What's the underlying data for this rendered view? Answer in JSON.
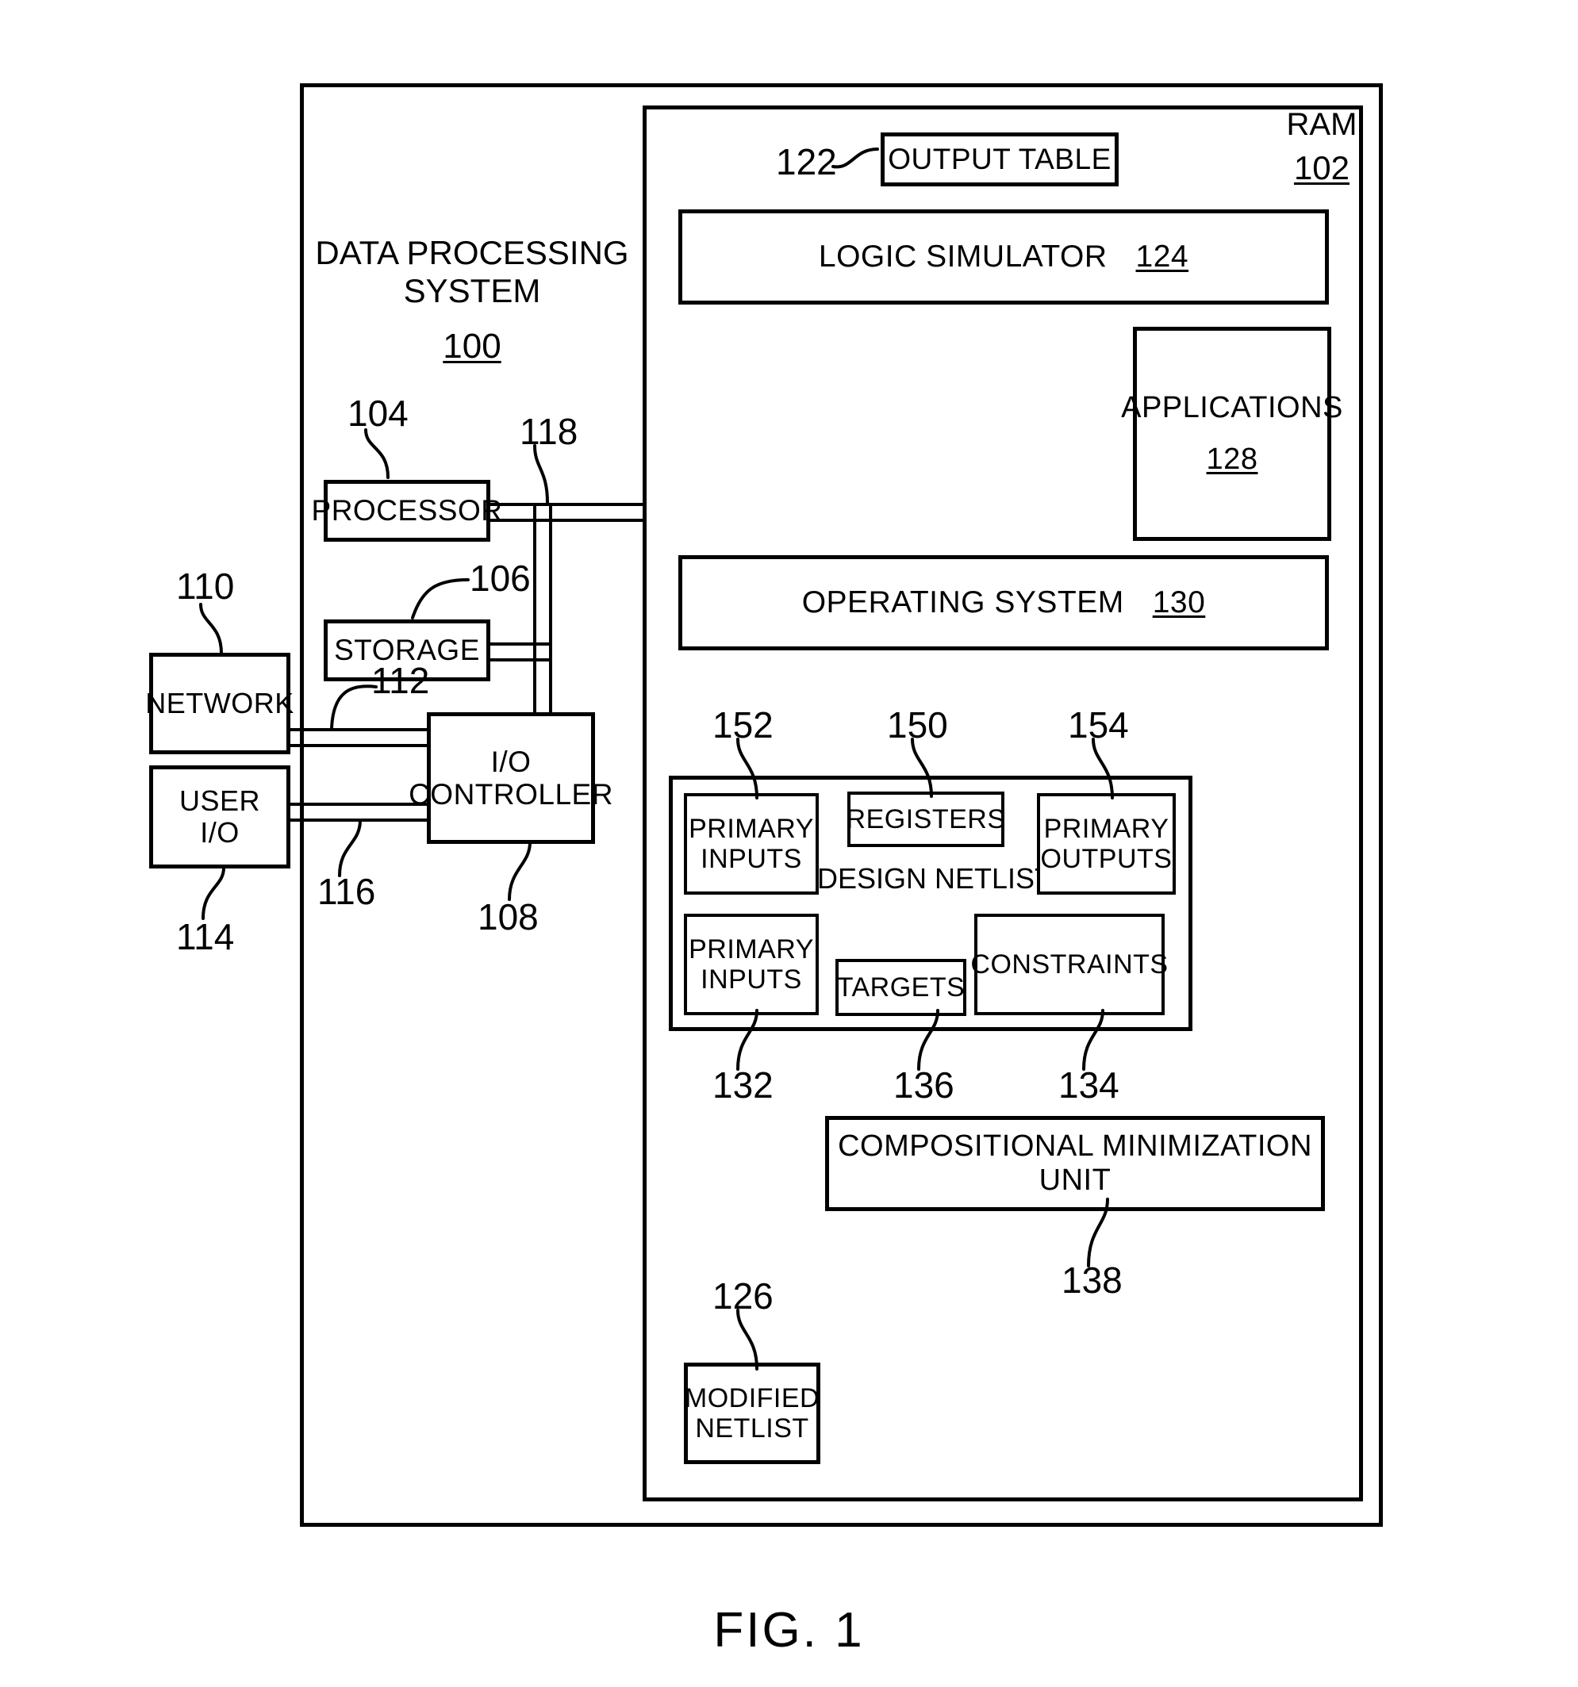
{
  "figure": {
    "caption": "FIG. 1"
  },
  "system": {
    "title_line1": "DATA PROCESSING",
    "title_line2": "SYSTEM",
    "ref": "100"
  },
  "ram": {
    "label": "RAM",
    "ref": "102"
  },
  "blocks": {
    "processor": {
      "label": "PROCESSOR",
      "ref": "104"
    },
    "storage": {
      "label": "STORAGE",
      "ref": "106"
    },
    "io_controller": {
      "label_line1": "I/O",
      "label_line2": "CONTROLLER",
      "ref": "108"
    },
    "network": {
      "label": "NETWORK",
      "ref": "110"
    },
    "user_io": {
      "label_line1": "USER",
      "label_line2": "I/O",
      "ref": "114"
    },
    "output_table": {
      "label": "OUTPUT TABLE",
      "ref": "122"
    },
    "logic_simulator": {
      "label": "LOGIC SIMULATOR",
      "ref": "124"
    },
    "applications": {
      "label": "APPLICATIONS",
      "ref": "128"
    },
    "operating_system": {
      "label": "OPERATING SYSTEM",
      "ref": "130"
    },
    "design_netlist": {
      "label": "DESIGN NETLIST",
      "ref": "150"
    },
    "primary_inputs_top": {
      "label_line1": "PRIMARY",
      "label_line2": "INPUTS",
      "ref": "152"
    },
    "primary_outputs": {
      "label_line1": "PRIMARY",
      "label_line2": "OUTPUTS",
      "ref": "154"
    },
    "registers": {
      "label": "REGISTERS"
    },
    "primary_inputs_bottom": {
      "label_line1": "PRIMARY",
      "label_line2": "INPUTS",
      "ref": "132"
    },
    "targets": {
      "label": "TARGETS",
      "ref": "136"
    },
    "constraints": {
      "label": "CONSTRAINTS",
      "ref": "134"
    },
    "compositional_minimization_unit": {
      "label": "COMPOSITIONAL MINIMIZATION UNIT",
      "ref": "138"
    },
    "modified_netlist": {
      "label_line1": "MODIFIED",
      "label_line2": "NETLIST",
      "ref": "126"
    }
  },
  "buses": {
    "system_bus": {
      "ref": "118"
    },
    "network_link": {
      "ref": "112"
    },
    "user_io_link": {
      "ref": "116"
    }
  },
  "colors": {
    "ink": "#000000",
    "paper": "#ffffff"
  }
}
